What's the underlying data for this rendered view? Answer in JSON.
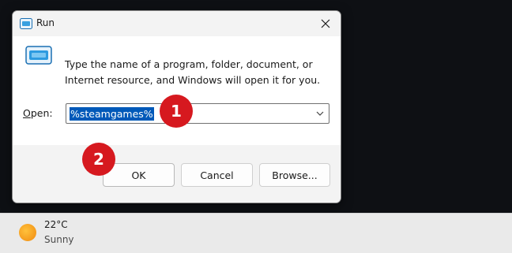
{
  "dialog": {
    "title": "Run",
    "description": "Type the name of a program, folder, document, or Internet resource, and Windows will open it for you.",
    "open_label_underlined": "O",
    "open_label_rest": "pen:",
    "open_value": "%steamgames%",
    "buttons": {
      "ok": "OK",
      "cancel": "Cancel",
      "browse": "Browse..."
    }
  },
  "annotations": {
    "step1": "1",
    "step2": "2",
    "color": "#d6191f"
  },
  "taskbar": {
    "weather": {
      "temperature": "22°C",
      "condition": "Sunny",
      "icon": "sun-icon"
    }
  }
}
